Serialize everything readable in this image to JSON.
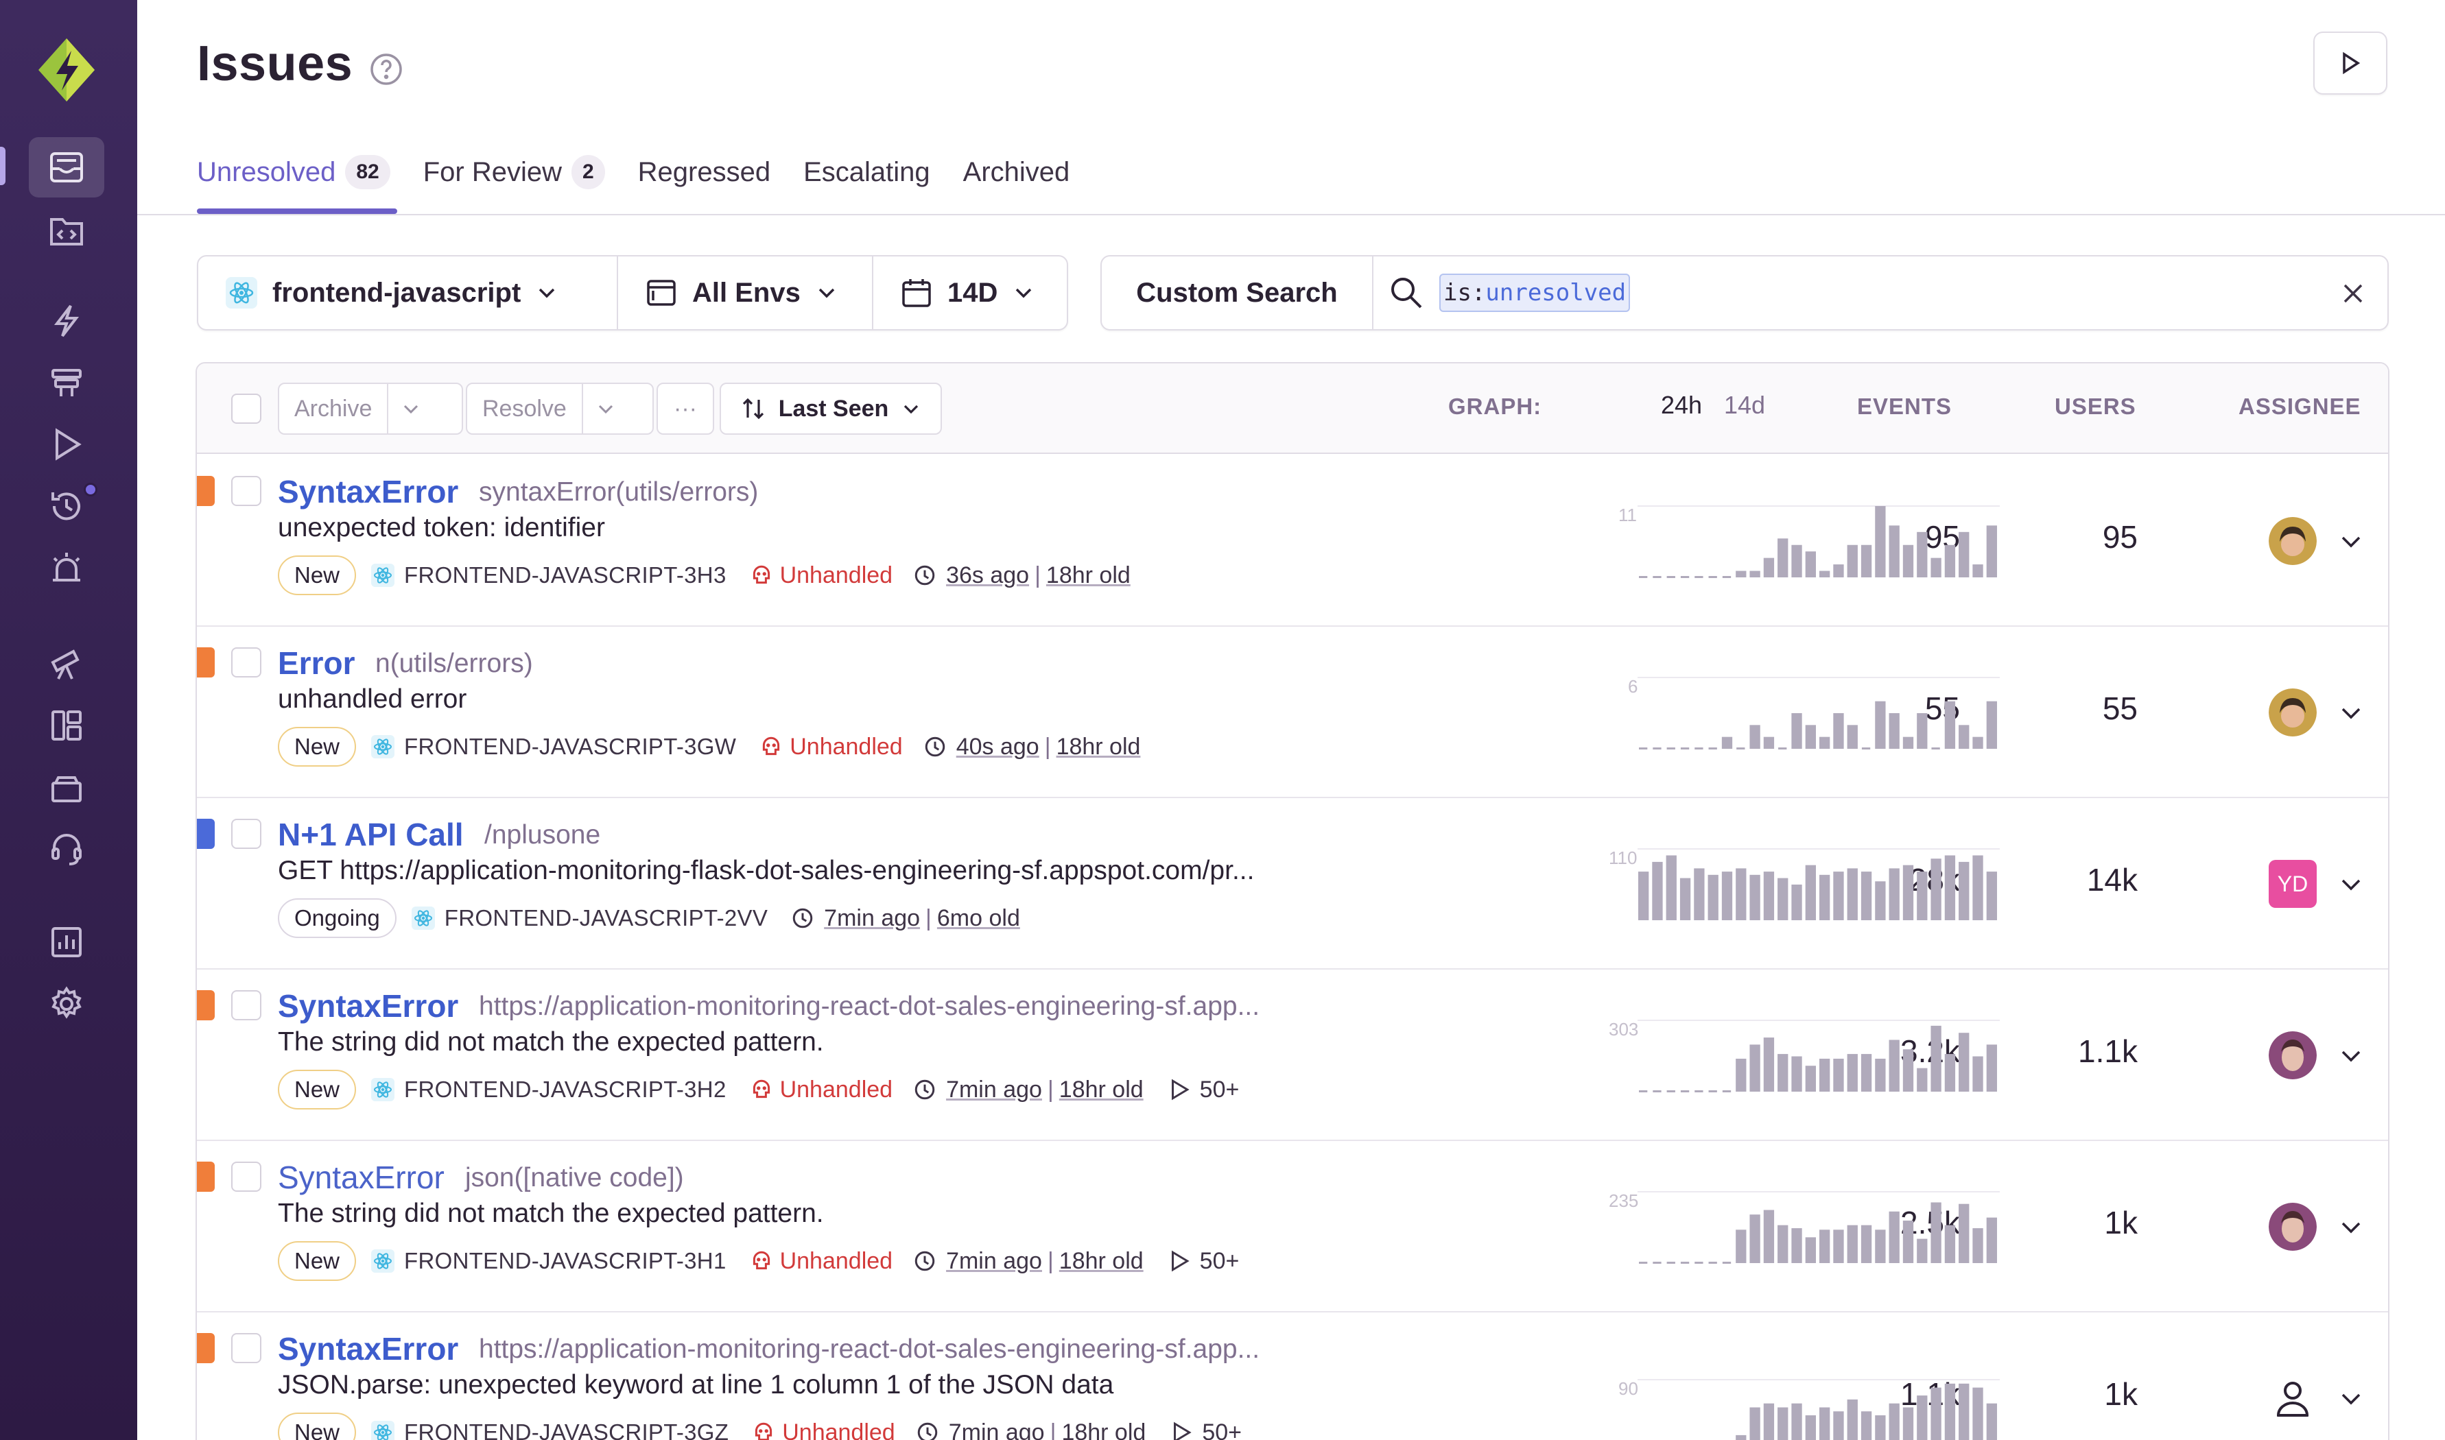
{
  "page": {
    "title": "Issues"
  },
  "tabs": [
    {
      "label": "Unresolved",
      "count": "82",
      "active": true
    },
    {
      "label": "For Review",
      "count": "2",
      "active": false
    },
    {
      "label": "Regressed",
      "count": "",
      "active": false
    },
    {
      "label": "Escalating",
      "count": "",
      "active": false
    },
    {
      "label": "Archived",
      "count": "",
      "active": false
    }
  ],
  "filters": {
    "project": "frontend-javascript",
    "environment": "All Envs",
    "period": "14D",
    "custom_search_label": "Custom Search",
    "query_key": "is:",
    "query_value": "unresolved"
  },
  "toolbar": {
    "archive_label": "Archive",
    "resolve_label": "Resolve",
    "more_label": "···",
    "sort_label": "Last Seen"
  },
  "columns": {
    "graph": "GRAPH:",
    "period_24h": "24h",
    "period_14d": "14d",
    "events": "EVENTS",
    "users": "USERS",
    "assignee": "ASSIGNEE"
  },
  "colors": {
    "accent": "#6c5fc7",
    "link": "#3d5ccc",
    "level_error": "#f07e3a",
    "level_info": "#4b6ad9",
    "unhandled": "#d23a3a",
    "spark": "#b0aabb"
  },
  "issues": [
    {
      "type": "SyntaxError",
      "type_weight": "bold",
      "level_color": "#f07e3a",
      "location": "syntaxError(utils/errors)",
      "message": "unexpected token: identifier",
      "status": "New",
      "short_id": "FRONTEND-JAVASCRIPT-3H3",
      "unhandled": "Unhandled",
      "last_seen": "36s ago",
      "age": "18hr old",
      "replays": "",
      "spark_max": "11",
      "spark": [
        0,
        0,
        0,
        0,
        0,
        0,
        0,
        1,
        1,
        3,
        6,
        5,
        4,
        1,
        2,
        5,
        5,
        11,
        8,
        5,
        7,
        3,
        5,
        7,
        2,
        8
      ],
      "events": "95",
      "users": "95",
      "assignee": "avatar-woman"
    },
    {
      "type": "Error",
      "type_weight": "bold",
      "level_color": "#f07e3a",
      "location": "n(utils/errors)",
      "message": "unhandled error",
      "status": "New",
      "short_id": "FRONTEND-JAVASCRIPT-3GW",
      "unhandled": "Unhandled",
      "last_seen": "40s ago",
      "age": "18hr old",
      "replays": "",
      "spark_max": "6",
      "spark": [
        0,
        0,
        0,
        0,
        0,
        0,
        1,
        0,
        2,
        1,
        0,
        3,
        2,
        1,
        3,
        2,
        0,
        4,
        3,
        1,
        3,
        0,
        4,
        2,
        1,
        4
      ],
      "events": "55",
      "users": "55",
      "assignee": "avatar-woman"
    },
    {
      "type": "N+1 API Call",
      "type_weight": "bold",
      "level_color": "#4b6ad9",
      "location": "/nplusone",
      "message": "GET https://application-monitoring-flask-dot-sales-engineering-sf.appspot.com/pr...",
      "status": "Ongoing",
      "short_id": "FRONTEND-JAVASCRIPT-2VV",
      "unhandled": "",
      "last_seen": "7min ago",
      "age": "6mo old",
      "replays": "",
      "spark_max": "110",
      "spark": [
        75,
        90,
        100,
        65,
        80,
        70,
        75,
        80,
        70,
        75,
        65,
        55,
        85,
        70,
        75,
        80,
        75,
        60,
        80,
        85,
        75,
        95,
        100,
        90,
        100,
        75
      ],
      "events": "28k",
      "users": "14k",
      "assignee": "YD"
    },
    {
      "type": "SyntaxError",
      "type_weight": "bold",
      "level_color": "#f07e3a",
      "location": "https://application-monitoring-react-dot-sales-engineering-sf.app...",
      "message": "The string did not match the expected pattern.",
      "status": "New",
      "short_id": "FRONTEND-JAVASCRIPT-3H2",
      "unhandled": "Unhandled",
      "last_seen": "7min ago",
      "age": "18hr old",
      "replays": "50+",
      "spark_max": "303",
      "spark": [
        0,
        0,
        0,
        0,
        0,
        0,
        0,
        140,
        200,
        230,
        160,
        150,
        110,
        140,
        140,
        160,
        160,
        140,
        220,
        180,
        100,
        280,
        160,
        250,
        150,
        200
      ],
      "events": "3.2k",
      "users": "1.1k",
      "assignee": "avatar-man"
    },
    {
      "type": "SyntaxError",
      "type_weight": "normal",
      "level_color": "#f07e3a",
      "location": "json([native code])",
      "message": "The string did not match the expected pattern.",
      "status": "New",
      "short_id": "FRONTEND-JAVASCRIPT-3H1",
      "unhandled": "Unhandled",
      "last_seen": "7min ago",
      "age": "18hr old",
      "replays": "50+",
      "spark_max": "235",
      "spark": [
        0,
        0,
        0,
        0,
        0,
        0,
        0,
        110,
        160,
        175,
        125,
        115,
        85,
        110,
        110,
        125,
        125,
        110,
        170,
        140,
        80,
        200,
        125,
        195,
        115,
        150
      ],
      "events": "2.5k",
      "users": "1k",
      "assignee": "avatar-man"
    },
    {
      "type": "SyntaxError",
      "type_weight": "bold",
      "level_color": "#f07e3a",
      "location": "https://application-monitoring-react-dot-sales-engineering-sf.app...",
      "message": "JSON.parse: unexpected keyword at line 1 column 1 of the JSON data",
      "status": "New",
      "short_id": "FRONTEND-JAVASCRIPT-3GZ",
      "unhandled": "Unhandled",
      "last_seen": "7min ago",
      "age": "18hr old",
      "replays": "50+",
      "spark_max": "90",
      "spark": [
        0,
        0,
        0,
        0,
        0,
        0,
        0,
        20,
        55,
        60,
        55,
        60,
        45,
        55,
        50,
        65,
        50,
        45,
        60,
        55,
        70,
        80,
        85,
        85,
        80,
        60
      ],
      "events": "1.1k",
      "users": "1k",
      "assignee": "unassigned"
    }
  ]
}
